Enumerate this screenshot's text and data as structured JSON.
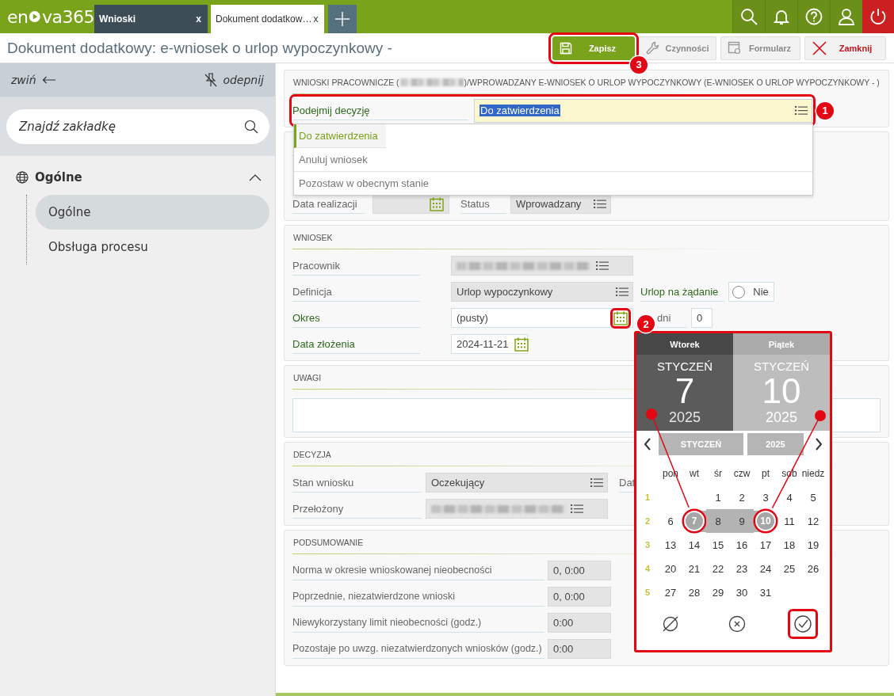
{
  "top_bar": {
    "logo": [
      "en",
      "va365"
    ],
    "tabs": [
      {
        "label": "Wnioski",
        "close": "x",
        "selected": false
      },
      {
        "label": "Dokument dodatkow…",
        "close": "x",
        "selected": true
      }
    ]
  },
  "header": {
    "title": "Dokument dodatkowy: e-wniosek o urlop wypoczynkowy -",
    "buttons": [
      {
        "label": "Zapisz",
        "kind": "save",
        "disabled": false,
        "highlighted": true,
        "callout": "3"
      },
      {
        "label": "Czynności",
        "kind": "actions",
        "disabled": true,
        "highlighted": false
      },
      {
        "label": "Formularz",
        "kind": "form",
        "disabled": true,
        "highlighted": false
      },
      {
        "label": "Zamknij",
        "kind": "close",
        "disabled": false,
        "highlighted": false
      }
    ]
  },
  "sidebar": {
    "collapse": "zwiń",
    "unpin": "odepnij",
    "search": {
      "placeholder": "Znajdź zakładkę"
    },
    "tree": [
      {
        "label": "Ogólne",
        "expanded": true,
        "selected": false,
        "children": [
          {
            "label": "Ogólne",
            "selected": true
          },
          {
            "label": "Obsługa procesu",
            "selected": false
          }
        ]
      }
    ]
  },
  "sections": [
    {
      "kind": "decision",
      "title": "WNIOSKI PRACOWNICZE (",
      "redacted": true,
      "title_continued": ")/WPROWADZANY E-WNIOSEK O URLOP WYPOCZYNKOWY (E-WNIOSEK O URLOP WYPOCZYNKOWY - )",
      "rows": [
        {
          "label": "Podejmij decyzję",
          "required": true,
          "highlighted": true,
          "callout": "1",
          "field": {
            "kind": "choice",
            "value": "Do zatwierdzenia",
            "readonly": false,
            "focused": true,
            "open": true,
            "options": [
              {
                "label": "Do zatwierdzenia",
                "selected": true,
                "highlighted": true
              },
              {
                "label": "Anuluj wniosek",
                "selected": false,
                "highlighted": false
              },
              {
                "label": "Pozostaw w obecnym stanie",
                "selected": false,
                "highlighted": false
              }
            ]
          }
        }
      ]
    },
    {
      "kind": "details",
      "rows": [
        {
          "label": "Data realizacji",
          "required": false,
          "highlighted": false,
          "field": {
            "kind": "date",
            "readonly": true,
            "icon_highlighted": false
          },
          "side": {
            "label": "Status",
            "required": false,
            "field": {
              "kind": "choice",
              "value": "Wprowadzany",
              "readonly": true
            }
          }
        }
      ]
    },
    {
      "kind": "request",
      "title": "WNIOSEK",
      "rows": [
        {
          "label": "Pracownik",
          "required": false,
          "highlighted": false,
          "field": {
            "kind": "choice",
            "readonly": true,
            "redacted": true
          }
        },
        {
          "label": "Definicja",
          "required": false,
          "highlighted": false,
          "field": {
            "kind": "choice",
            "value": "Urlop wypoczynkowy",
            "readonly": true
          },
          "side": {
            "label": "Urlop na żądanie",
            "required": true,
            "field": {
              "kind": "radio",
              "value": "Nie",
              "checked": false,
              "readonly": false
            }
          }
        },
        {
          "label": "Okres",
          "required": true,
          "highlighted": false,
          "field": {
            "kind": "date_range",
            "value": "(pusty)",
            "readonly": false,
            "icon_highlighted": true,
            "callout": "2",
            "picker": {
              "highlighted": true,
              "mark_selected_days": true,
              "range": [
                {
                  "weekday": "Wtorek",
                  "month": "STYCZEŃ",
                  "day": "7",
                  "year": "2025",
                  "selected": true
                },
                {
                  "weekday": "Piątek",
                  "month": "STYCZEŃ",
                  "day": "10",
                  "year": "2025",
                  "selected": false
                }
              ],
              "month": "STYCZEŃ",
              "year": "2025",
              "weekdays": [
                "pon",
                "wt",
                "śr",
                "czw",
                "pt",
                "sob",
                "niedz"
              ],
              "weeks": [
                {
                  "number": "1",
                  "days": [
                    {
                      "label": "1",
                      "selected": false,
                      "in_range": false
                    },
                    {
                      "label": "2",
                      "selected": false,
                      "in_range": false
                    },
                    {
                      "label": "3",
                      "selected": false,
                      "in_range": false
                    },
                    {
                      "label": "4",
                      "selected": false,
                      "in_range": false
                    },
                    {
                      "label": "5",
                      "selected": false,
                      "in_range": false
                    }
                  ]
                },
                {
                  "number": "2",
                  "days": [
                    {
                      "label": "6",
                      "selected": false,
                      "in_range": false
                    },
                    {
                      "label": "7",
                      "selected": true,
                      "in_range": true
                    },
                    {
                      "label": "8",
                      "selected": false,
                      "in_range": true
                    },
                    {
                      "label": "9",
                      "selected": false,
                      "in_range": true
                    },
                    {
                      "label": "10",
                      "selected": true,
                      "in_range": true
                    },
                    {
                      "label": "11",
                      "selected": false,
                      "in_range": false
                    },
                    {
                      "label": "12",
                      "selected": false,
                      "in_range": false
                    }
                  ]
                },
                {
                  "number": "3",
                  "days": [
                    {
                      "label": "13",
                      "selected": false,
                      "in_range": false
                    },
                    {
                      "label": "14",
                      "selected": false,
                      "in_range": false
                    },
                    {
                      "label": "15",
                      "selected": false,
                      "in_range": false
                    },
                    {
                      "label": "16",
                      "selected": false,
                      "in_range": false
                    },
                    {
                      "label": "17",
                      "selected": false,
                      "in_range": false
                    },
                    {
                      "label": "18",
                      "selected": false,
                      "in_range": false
                    },
                    {
                      "label": "19",
                      "selected": false,
                      "in_range": false
                    }
                  ]
                },
                {
                  "number": "4",
                  "days": [
                    {
                      "label": "20",
                      "selected": false,
                      "in_range": false
                    },
                    {
                      "label": "21",
                      "selected": false,
                      "in_range": false
                    },
                    {
                      "label": "22",
                      "selected": false,
                      "in_range": false
                    },
                    {
                      "label": "23",
                      "selected": false,
                      "in_range": false
                    },
                    {
                      "label": "24",
                      "selected": false,
                      "in_range": false
                    },
                    {
                      "label": "25",
                      "selected": false,
                      "in_range": false
                    },
                    {
                      "label": "26",
                      "selected": false,
                      "in_range": false
                    }
                  ]
                },
                {
                  "number": "5",
                  "days": [
                    {
                      "label": "27",
                      "selected": false,
                      "in_range": false
                    },
                    {
                      "label": "28",
                      "selected": false,
                      "in_range": false
                    },
                    {
                      "label": "29",
                      "selected": false,
                      "in_range": false
                    },
                    {
                      "label": "30",
                      "selected": false,
                      "in_range": false
                    },
                    {
                      "label": "31",
                      "selected": false,
                      "in_range": false
                    }
                  ]
                }
              ],
              "actions": [
                {
                  "kind": "clear",
                  "highlighted": false
                },
                {
                  "kind": "cancel",
                  "highlighted": false
                },
                {
                  "kind": "confirm",
                  "highlighted": true
                }
              ]
            }
          },
          "side": {
            "label": "dni",
            "required": false,
            "field": {
              "kind": "text",
              "value": "0",
              "readonly": false
            }
          }
        },
        {
          "label": "Data złożenia",
          "required": true,
          "highlighted": false,
          "field": {
            "kind": "date",
            "value": "2024-11-21",
            "readonly": false,
            "icon_highlighted": false
          }
        }
      ]
    },
    {
      "kind": "comments",
      "title": "UWAGI",
      "rows": [
        {
          "field": {
            "kind": "memo",
            "readonly": false
          }
        }
      ]
    },
    {
      "kind": "decision_status",
      "title": "DECYZJA",
      "rows": [
        {
          "label": "Stan wniosku",
          "required": false,
          "highlighted": false,
          "field": {
            "kind": "choice",
            "value": "Oczekujący",
            "readonly": true
          },
          "side": {
            "label": "Dat",
            "required": false
          }
        },
        {
          "label": "Przełożony",
          "required": false,
          "highlighted": false,
          "field": {
            "kind": "choice",
            "readonly": true,
            "redacted": true
          }
        }
      ]
    },
    {
      "kind": "summary",
      "title": "PODSUMOWANIE",
      "rows": [
        {
          "label": "Norma w okresie wnioskowanej nieobecności",
          "required": false,
          "highlighted": false,
          "field": {
            "kind": "text",
            "value": "0, 0:00",
            "readonly": true
          }
        },
        {
          "label": "Poprzednie, niezatwierdzone wnioski",
          "required": false,
          "highlighted": false,
          "field": {
            "kind": "text",
            "value": "0, 0:00",
            "readonly": true
          }
        },
        {
          "label": "Niewykorzystany limit nieobecności (godz.)",
          "required": false,
          "highlighted": false,
          "field": {
            "kind": "text",
            "value": "0:00",
            "readonly": true
          }
        },
        {
          "label": "Pozostaje po uwzg. niezatwierdzonych wniosków (godz.)",
          "required": false,
          "highlighted": false,
          "field": {
            "kind": "text",
            "value": "0:00",
            "readonly": true
          }
        }
      ]
    }
  ]
}
